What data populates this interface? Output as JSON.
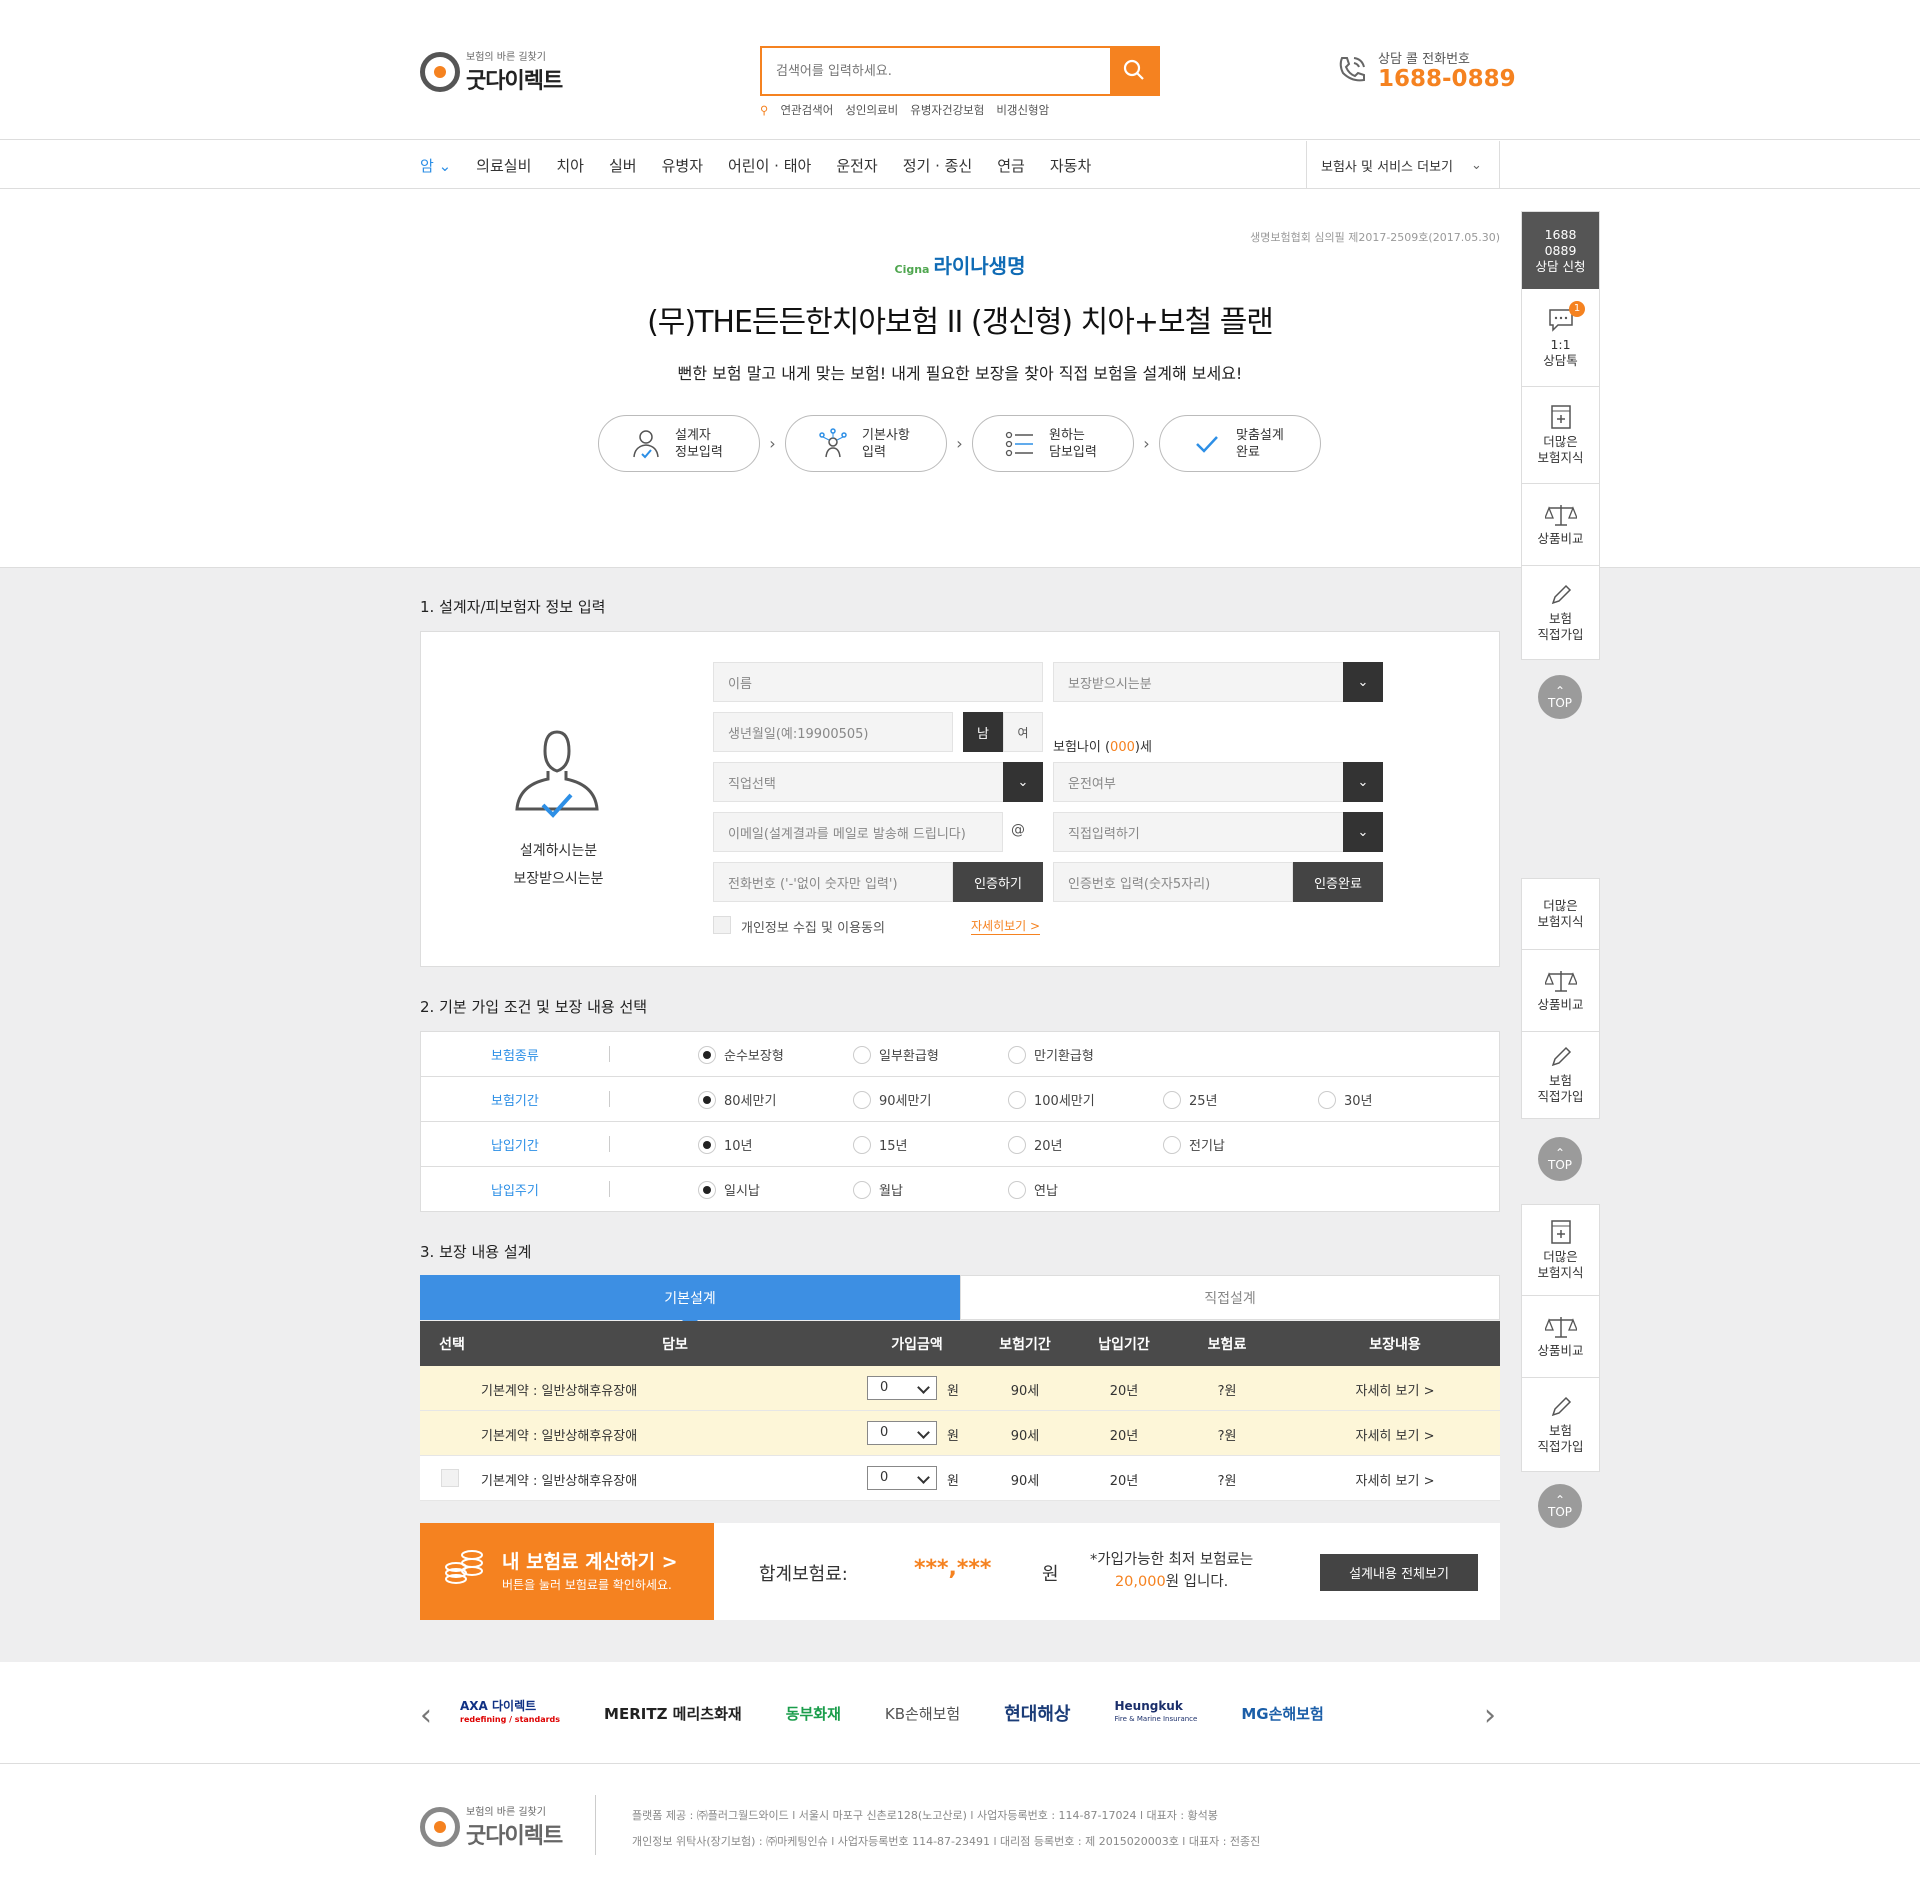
{
  "header": {
    "logo_tagline": "보험의 바른 길찾기",
    "logo_name": "굿다이렉트",
    "search_placeholder": "검색어를 입력하세요.",
    "related_label": "연관검색어",
    "related_terms": [
      "성인의료비",
      "유병자건강보험",
      "비갱신형암"
    ],
    "tel_label": "상담 콜 전화번호",
    "tel_number": "1688-0889",
    "brand_color": "#f58220"
  },
  "nav": {
    "items": [
      "암",
      "의료실비",
      "치아",
      "실버",
      "유병자",
      "어린이 · 태아",
      "운전자",
      "정기 · 종신",
      "연금",
      "자동차"
    ],
    "active_index": 0,
    "more_label": "보험사 및 서비스 더보기"
  },
  "product": {
    "review_code": "생명보험협회 심의필 제2017-2509호(2017.05.30)",
    "brand_logo_small": "Cigna",
    "brand_name": "라이나생명",
    "title": "(무)THE든든한치아보험 II (갱신형) 치아+보철 플랜",
    "subtitle": "뻔한 보험 말고 내게 맞는 보험! 내게 필요한 보장을 찾아 직접 보험을 설계해 보세요!",
    "steps": [
      {
        "line1": "설계자",
        "line2": "정보입력"
      },
      {
        "line1": "기본사항",
        "line2": "입력"
      },
      {
        "line1": "원하는",
        "line2": "담보입력"
      },
      {
        "line1": "맞춤설계",
        "line2": "완료"
      }
    ]
  },
  "section1": {
    "title": "1. 설계자/피보험자 정보 입력",
    "avatar_line1": "설계하시는분",
    "avatar_line2": "보장받으시는분",
    "name_placeholder": "이름",
    "insured_select": "보장받으시는분",
    "birth_placeholder": "생년월일(예:19900505)",
    "male": "남",
    "female": "여",
    "age_prefix": "보험나이 (",
    "age_value": "000",
    "age_suffix": ")세",
    "job_select": "직업선택",
    "drive_select": "운전여부",
    "email_placeholder": "이메일(설계결과를 메일로 발송해 드립니다)",
    "at": "@",
    "domain_select": "직접입력하기",
    "phone_placeholder": "전화번호 ('-'없이 숫자만 입력')",
    "verify_btn": "인증하기",
    "code_placeholder": "인증번호 입력(숫자5자리)",
    "verify_done_btn": "인증완료",
    "consent_label": "개인정보 수집 및 이용동의",
    "consent_link": "자세히보기 >"
  },
  "section2": {
    "title": "2. 기본 가입 조건 및 보장 내용 선택",
    "rows": [
      {
        "label": "보험종류",
        "options": [
          "순수보장형",
          "일부환급형",
          "만기환급형"
        ],
        "selected": 0
      },
      {
        "label": "보험기간",
        "options": [
          "80세만기",
          "90세만기",
          "100세만기",
          "25년",
          "30년"
        ],
        "selected": 0
      },
      {
        "label": "납입기간",
        "options": [
          "10년",
          "15년",
          "20년",
          "전기납"
        ],
        "selected": 0
      },
      {
        "label": "납입주기",
        "options": [
          "일시납",
          "월납",
          "연납"
        ],
        "selected": 0
      }
    ]
  },
  "section3": {
    "title": "3. 보장 내용 설계",
    "tab_basic": "기본설계",
    "tab_custom": "직접설계",
    "headers": [
      "선택",
      "담보",
      "가입금액",
      "보험기간",
      "납입기간",
      "보험료",
      "보장내용"
    ],
    "rows": [
      {
        "coverage": "기본계약 : 일반상해후유장애",
        "amount": "0",
        "unit": "원",
        "period": "90세",
        "pay": "20년",
        "premium": "?원",
        "detail": "자세히 보기 >",
        "highlight": true,
        "checkbox": false
      },
      {
        "coverage": "기본계약 : 일반상해후유장애",
        "amount": "0",
        "unit": "원",
        "period": "90세",
        "pay": "20년",
        "premium": "?원",
        "detail": "자세히 보기 >",
        "highlight": true,
        "checkbox": false
      },
      {
        "coverage": "기본계약 : 일반상해후유장애",
        "amount": "0",
        "unit": "원",
        "period": "90세",
        "pay": "20년",
        "premium": "?원",
        "detail": "자세히 보기 >",
        "highlight": false,
        "checkbox": true
      }
    ]
  },
  "calc": {
    "btn_title": "내 보험료 계산하기 >",
    "btn_sub": "버튼을 눌러 보험료를 확인하세요.",
    "total_label": "합계보험료:",
    "total_value": "***,***",
    "won": "원",
    "min_note_1": "*가입가능한 최저 보험료는",
    "min_value": "20,000",
    "min_note_2": "원 입니다.",
    "view_all_btn": "설계내용 전체보기"
  },
  "sidebar": {
    "call_lines": [
      "1688",
      "0889",
      "상담 신청"
    ],
    "chat_badge": "1",
    "chat_lines": [
      "1:1",
      "상담톡"
    ],
    "knowledge_lines": [
      "더많은",
      "보험지식"
    ],
    "compare_label": "상품비교",
    "join_lines": [
      "보험",
      "직접가입"
    ],
    "top_label": "TOP"
  },
  "partners": {
    "logos": [
      "AXA 다이렉트",
      "MERITZ 메리츠화재",
      "동부화재",
      "KB손해보험",
      "현대해상",
      "Heungkuk",
      "MG손해보험"
    ],
    "axa_tagline": "redefining / standards",
    "heungkuk_tagline": "Fire & Marine Insurance"
  },
  "footer": {
    "logo_tagline": "보험의 바른 길찾기",
    "logo_name": "굿다이렉트",
    "line1": "플랫폼 제공 : ㈜플러그월드와이드  l  서울시 마포구 신촌로128(노고산로)  l  사업자등록번호 : 114-87-17024  l  대표자 : 황석봉",
    "line2": "개인정보 위탁사(장기보험) : ㈜마케팅인슈  l  사업자등록번호 114-87-23491  l  대리점 등록번호 : 제 2015020003호  l  대표자 : 전종진"
  }
}
